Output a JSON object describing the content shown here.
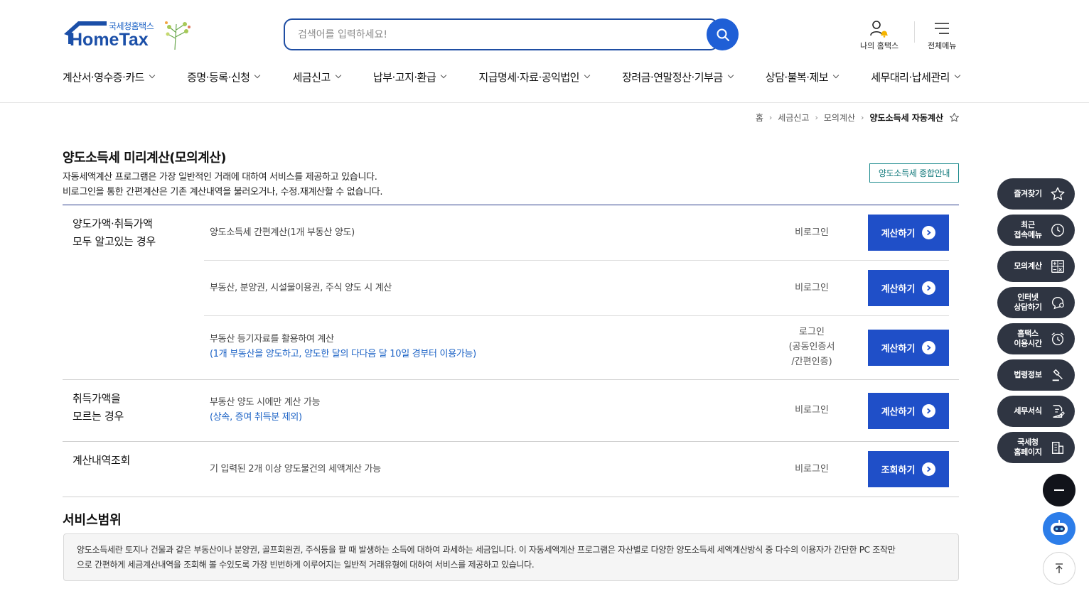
{
  "header": {
    "logo_sub": "국세청홈택스",
    "logo_main": "HomeTax",
    "search_placeholder": "검색어를 입력하세요!",
    "my_hometax": "나의 홈택스",
    "all_menu": "전체메뉴"
  },
  "gnb": [
    {
      "label": "계산서·영수증·카드"
    },
    {
      "label": "증명·등록·신청"
    },
    {
      "label": "세금신고"
    },
    {
      "label": "납부·고지·환급"
    },
    {
      "label": "지급명세·자료·공익법인"
    },
    {
      "label": "장려금·연말정산·기부금"
    },
    {
      "label": "상담·불복·제보"
    },
    {
      "label": "세무대리·납세관리"
    }
  ],
  "breadcrumb": [
    "홈",
    "세금신고",
    "모의계산",
    "양도소득세 자동계산"
  ],
  "page": {
    "title": "양도소득세 미리계산(모의계산)",
    "desc1": "자동세액계산 프로그램은 가장 일반적인 거래에 대하여 서비스를 제공하고 있습니다.",
    "desc2": "비로그인을 통한 간편계산은 기존 계산내역을 불러오거나, 수정.재계산할 수 없습니다.",
    "guide_button": "양도소득세 종합안내"
  },
  "table": {
    "group1": {
      "head1": "양도가액·취득가액",
      "head2": "모두 알고있는 경우",
      "rows": [
        {
          "text": "양도소득세 간편계산(1개 부동산 양도)",
          "login": "비로그인",
          "button": "계산하기"
        },
        {
          "text": "부동산, 분양권, 시설물이용권, 주식 양도 시 계산",
          "login": "비로그인",
          "button": "계산하기"
        },
        {
          "text": "부동산 등기자료를 활용하여 계산",
          "note": "(1개 부동산을 양도하고, 양도한 달의 다다음 달 10일 경부터 이용가능)",
          "login1": "로그인",
          "login2": "(공동인증서",
          "login3": "/간편인증)",
          "button": "계산하기"
        }
      ]
    },
    "group2": {
      "head1": "취득가액을",
      "head2": "모르는 경우",
      "text": "부동산 양도 시에만 계산 가능",
      "note": "(상속, 증여 취득분 제외)",
      "login": "비로그인",
      "button": "계산하기"
    },
    "group3": {
      "head": "계산내역조회",
      "text": "기 입력된 2개 이상 양도물건의 세액계산 가능",
      "login": "비로그인",
      "button": "조회하기"
    }
  },
  "service": {
    "title": "서비스범위",
    "line1": "양도소득세란 토지나 건물과 같은 부동산이나 분양권, 골프회원권, 주식등을 팔 때 발생하는 소득에 대하여 과세하는 세금입니다. 이 자동세액계산 프로그램은 자산별로 다양한 양도소득세 세액계산방식 중 다수의 이용자가 간단한 PC 조작만",
    "line2": "으로 간편하게 세금계산내역을 조회해 볼 수있도록 가장 빈번하게 이루어지는 일반적 거래유형에 대하여 서비스를 제공하고 있습니다."
  },
  "quick_menu": [
    {
      "line1": "즐겨찾기",
      "line2": "",
      "icon": "star-icon"
    },
    {
      "line1": "최근",
      "line2": "접속메뉴",
      "icon": "clock-icon"
    },
    {
      "line1": "모의계산",
      "line2": "",
      "icon": "calculator-icon"
    },
    {
      "line1": "인터넷",
      "line2": "상담하기",
      "icon": "chat-icon"
    },
    {
      "line1": "홈택스",
      "line2": "이용시간",
      "icon": "alarm-clock-icon"
    },
    {
      "line1": "법령정보",
      "line2": "",
      "icon": "gavel-icon"
    },
    {
      "line1": "세무서식",
      "line2": "",
      "icon": "document-edit-icon"
    },
    {
      "line1": "국세청",
      "line2": "홈페이지",
      "icon": "building-icon"
    }
  ],
  "colors": {
    "primary": "#1f4fc8",
    "navy": "#2b3e8c",
    "note_blue": "#1d63c6",
    "quick_bg": "#2f3542",
    "teal": "#137a7c"
  }
}
